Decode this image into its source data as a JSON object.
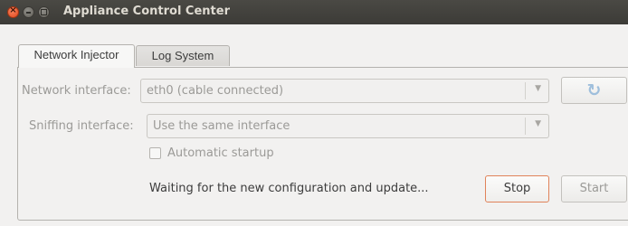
{
  "window": {
    "title": "Appliance Control Center"
  },
  "tabs": [
    {
      "label": "Network Injector",
      "active": true
    },
    {
      "label": "Log System",
      "active": false
    }
  ],
  "network_interface": {
    "label": "Network interface:",
    "value": "eth0 (cable connected)",
    "refresh_icon": "refresh-icon"
  },
  "sniffing_interface": {
    "label": "Sniffing interface:",
    "value": "Use the same interface"
  },
  "automatic_startup": {
    "label": "Automatic startup",
    "checked": false
  },
  "status": {
    "text": "Waiting for the new configuration and update..."
  },
  "buttons": {
    "stop": "Stop",
    "start": "Start"
  },
  "colors": {
    "titlebar": "#3c3b37",
    "close": "#e0461b",
    "stop_border": "#e0835a",
    "refresh": "#9fbfdc"
  }
}
